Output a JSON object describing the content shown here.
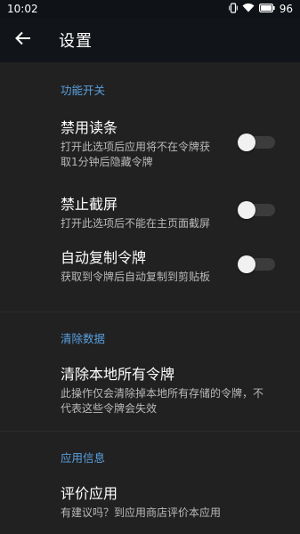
{
  "status_bar": {
    "time": "10:02",
    "battery": "96"
  },
  "app_bar": {
    "title": "设置"
  },
  "sections": {
    "features": {
      "header": "功能开关",
      "items": [
        {
          "title": "禁用读条",
          "subtitle_lines": [
            "打开此选项后应用将不在令牌获",
            "取1分钟后隐藏令牌"
          ],
          "enabled": false
        },
        {
          "title": "禁止截屏",
          "subtitle_lines": [
            "打开此选项后不能在主页面截屏"
          ],
          "enabled": false
        },
        {
          "title": "自动复制令牌",
          "subtitle_lines": [
            "获取到令牌后自动复制到剪贴板"
          ],
          "enabled": false
        }
      ]
    },
    "clear": {
      "header": "清除数据",
      "item": {
        "title": "清除本地所有令牌",
        "subtitle_lines": [
          "此操作仅会清除掉本地所有存储的令牌，不",
          "代表这些令牌会失效"
        ]
      }
    },
    "about": {
      "header": "应用信息",
      "item": {
        "title": "评价应用",
        "subtitle_lines": [
          "有建议吗？到应用商店评价本应用"
        ]
      }
    }
  },
  "colors": {
    "accent": "#5aa0e0",
    "background": "#212121",
    "app_bar": "#111418"
  },
  "icons": {
    "back": "arrow-left-icon",
    "signal": "vibrate-icon",
    "wifi": "wifi-icon",
    "battery": "battery-icon"
  }
}
